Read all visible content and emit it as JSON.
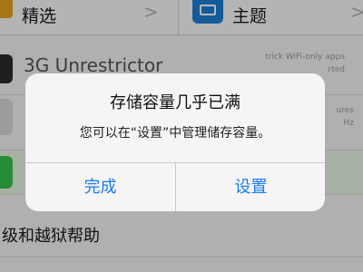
{
  "top": {
    "left_label": "精选",
    "right_label": "主题",
    "chevron": ">"
  },
  "rows": {
    "unrestrictor_title": "3G Unrestrictor",
    "unrestrictor_desc_lines": [
      "trick WiFi-only apps",
      "rted"
    ],
    "row2_desc_lines": [
      "ures",
      "Hz"
    ],
    "help_label": "级和越狱帮助"
  },
  "alert": {
    "title": "存储容量几乎已满",
    "message": "您可以在“设置”中管理储存容量。",
    "done_label": "完成",
    "settings_label": "设置"
  },
  "colors": {
    "accent": "#1a7af4",
    "green": "#35c24c",
    "theme_blue": "#1e7fd6",
    "orange": "#e8a21d"
  }
}
